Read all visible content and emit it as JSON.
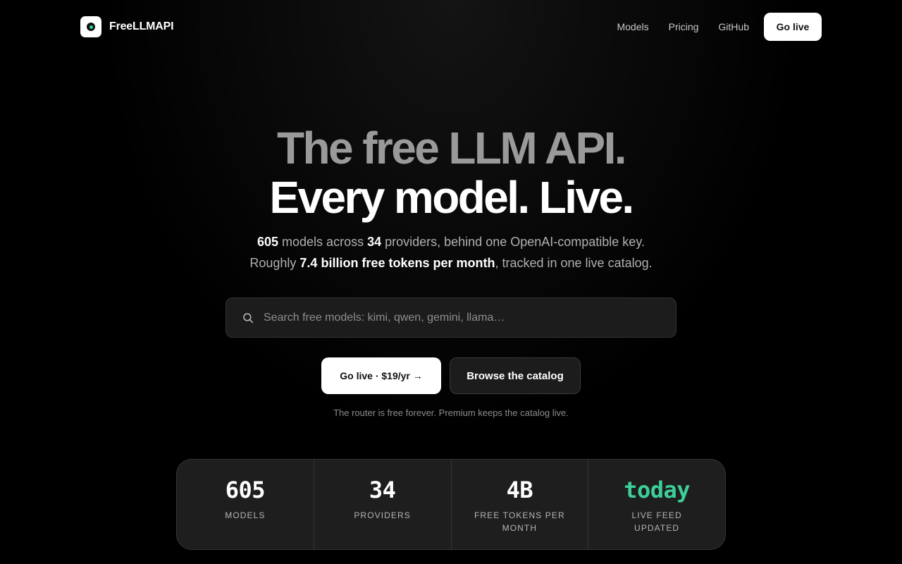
{
  "nav": {
    "brand": "FreeLLMAPI",
    "links": [
      "Models",
      "Pricing",
      "GitHub"
    ],
    "cta": "Go live"
  },
  "hero": {
    "line1": "The free LLM API.",
    "line2": "Every model. Live.",
    "sub1": {
      "models_count": "605",
      "t1": " models across ",
      "providers_count": "34",
      "t2": " providers, behind one OpenAI-compatible key."
    },
    "sub2": {
      "t1": "Roughly ",
      "tokens": "7.4 billion free tokens per month",
      "t2": ", tracked in one live catalog."
    }
  },
  "search": {
    "placeholder": "Search free models: kimi, qwen, gemini, llama…",
    "icon": "search-icon"
  },
  "buttons": {
    "primary": "Go live · $19/yr →",
    "secondary": "Browse the catalog"
  },
  "note": "The router is free forever. Premium keeps the catalog live.",
  "stats": [
    {
      "value": "605",
      "label": "Models"
    },
    {
      "value": "34",
      "label": "Providers"
    },
    {
      "value": "4B",
      "label": "Free tokens per month"
    },
    {
      "value": "today",
      "label": "Live feed updated"
    }
  ],
  "colors": {
    "background": "#000000",
    "accent": "#3ccf98",
    "primary_button": "#ffffff",
    "surface": "#1c1c1c"
  }
}
